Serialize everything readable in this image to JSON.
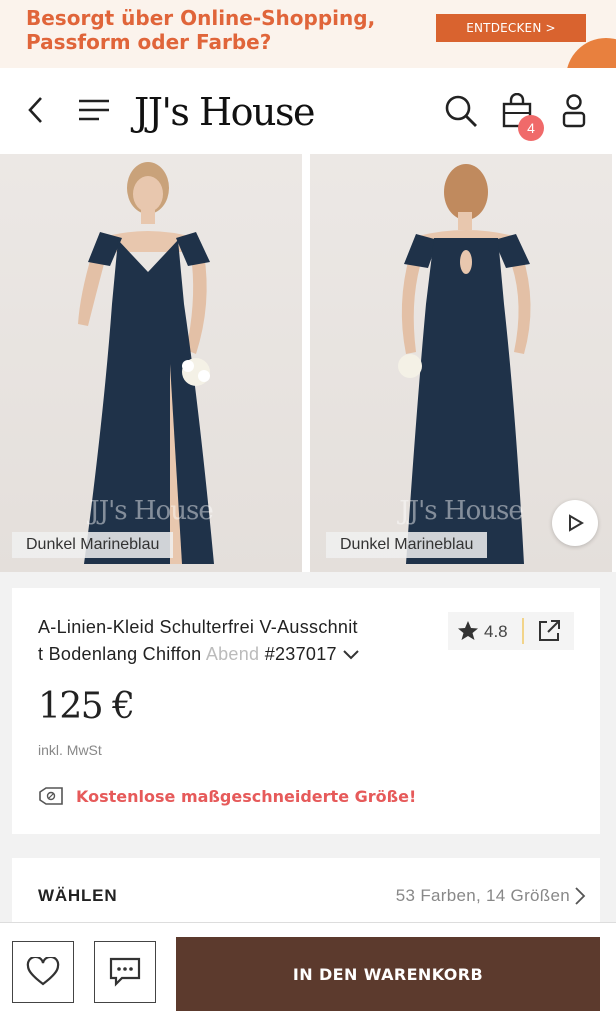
{
  "promo": {
    "text": "Besorgt über Online-Shopping,\nPassform oder Farbe?",
    "button_label": "ENTDECKEN >"
  },
  "header": {
    "logo": "JJ's House",
    "cart_count": "4",
    "icons": [
      "back-icon",
      "menu-icon",
      "search-icon",
      "cart-icon",
      "user-icon"
    ]
  },
  "gallery": {
    "images": [
      {
        "watermark": "JJ's House",
        "color_tag": "Dunkel Marineblau"
      },
      {
        "watermark": "JJ's House",
        "color_tag": "Dunkel Marineblau"
      }
    ],
    "video_icon": "play-icon"
  },
  "product": {
    "title_line1": "A-Linien-Kleid Schulterfrei V-Ausschnit",
    "title_line2": "t Bodenlang Chiffon ",
    "title_faded": "Abend",
    "product_id": "#237017",
    "rating": "4.8",
    "price": "125 €",
    "tax_note": "inkl. MwSt",
    "custom_size": "Kostenlose maßgeschneiderte Größe!"
  },
  "select": {
    "label": "WÄHLEN",
    "value": "53 Farben, 14 Größen"
  },
  "bottom": {
    "cart_button": "IN DEN WARENKORB"
  },
  "colors": {
    "promo_text": "#e0653a",
    "promo_button": "#d9632f",
    "badge": "#f06a6a",
    "accent_text": "#e65a5a",
    "cart_button": "#5c3a2d",
    "dress": "#1f3249"
  }
}
